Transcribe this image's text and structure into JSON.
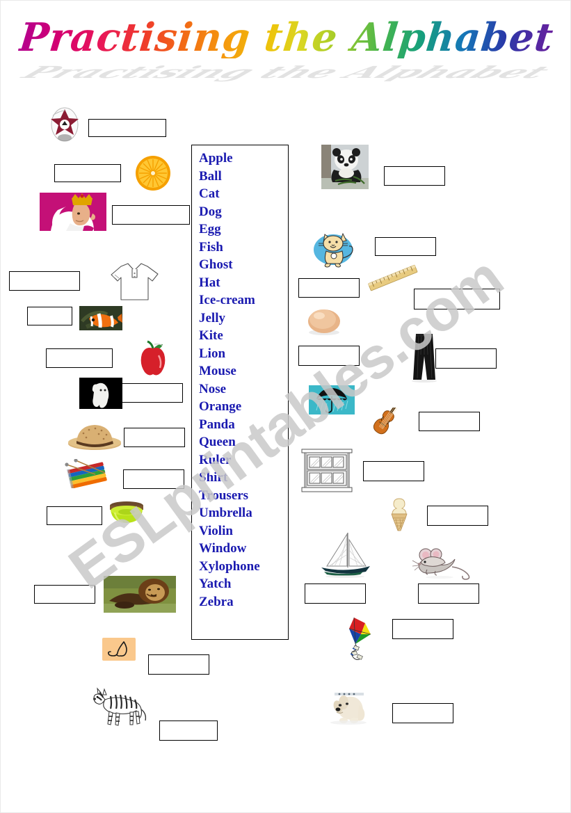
{
  "page": {
    "title": "Practising the Alphabet",
    "watermark": "ESLprintables.com",
    "background_color": "#ffffff"
  },
  "word_bank": {
    "name": "alphabet-word-bank",
    "text_color": "#1a1ab0",
    "words": [
      "Apple",
      "Ball",
      "Cat",
      "Dog",
      "Egg",
      "Fish",
      "Ghost",
      "Hat",
      "Ice-cream",
      "Jelly",
      "Kite",
      "Lion",
      "Mouse",
      "Nose",
      "Orange",
      "Panda",
      "Queen",
      "Ruler",
      "Shirt",
      "Trousers",
      "Umbrella",
      "Violin",
      "Window",
      "Xylophone",
      "Yatch",
      "Zebra"
    ]
  },
  "pictures": [
    {
      "icon": "soccer-ball-icon",
      "answer": "Ball"
    },
    {
      "icon": "orange-slice-icon",
      "answer": "Orange"
    },
    {
      "icon": "queen-icon",
      "answer": "Queen"
    },
    {
      "icon": "shirt-icon",
      "answer": "Shirt"
    },
    {
      "icon": "clownfish-icon",
      "answer": "Fish"
    },
    {
      "icon": "apple-icon",
      "answer": "Apple"
    },
    {
      "icon": "ghost-icon",
      "answer": "Ghost"
    },
    {
      "icon": "straw-hat-icon",
      "answer": "Hat"
    },
    {
      "icon": "xylophone-icon",
      "answer": "Xylophone"
    },
    {
      "icon": "jelly-icon",
      "answer": "Jelly"
    },
    {
      "icon": "lion-icon",
      "answer": "Lion"
    },
    {
      "icon": "nose-icon",
      "answer": "Nose"
    },
    {
      "icon": "zebra-icon",
      "answer": "Zebra"
    },
    {
      "icon": "panda-icon",
      "answer": "Panda"
    },
    {
      "icon": "cat-icon",
      "answer": "Cat"
    },
    {
      "icon": "ruler-icon",
      "answer": "Ruler"
    },
    {
      "icon": "egg-icon",
      "answer": "Egg"
    },
    {
      "icon": "trousers-icon",
      "answer": "Trousers"
    },
    {
      "icon": "umbrella-icon",
      "answer": "Umbrella"
    },
    {
      "icon": "violin-icon",
      "answer": "Violin"
    },
    {
      "icon": "window-icon",
      "answer": "Window"
    },
    {
      "icon": "ice-cream-icon",
      "answer": "Ice-cream"
    },
    {
      "icon": "sailboat-icon",
      "answer": "Yatch"
    },
    {
      "icon": "mouse-icon",
      "answer": "Mouse"
    },
    {
      "icon": "kite-icon",
      "answer": "Kite"
    },
    {
      "icon": "dog-icon",
      "answer": "Dog"
    }
  ],
  "answer_boxes": {
    "count": 26,
    "value": "",
    "placeholder": ""
  }
}
